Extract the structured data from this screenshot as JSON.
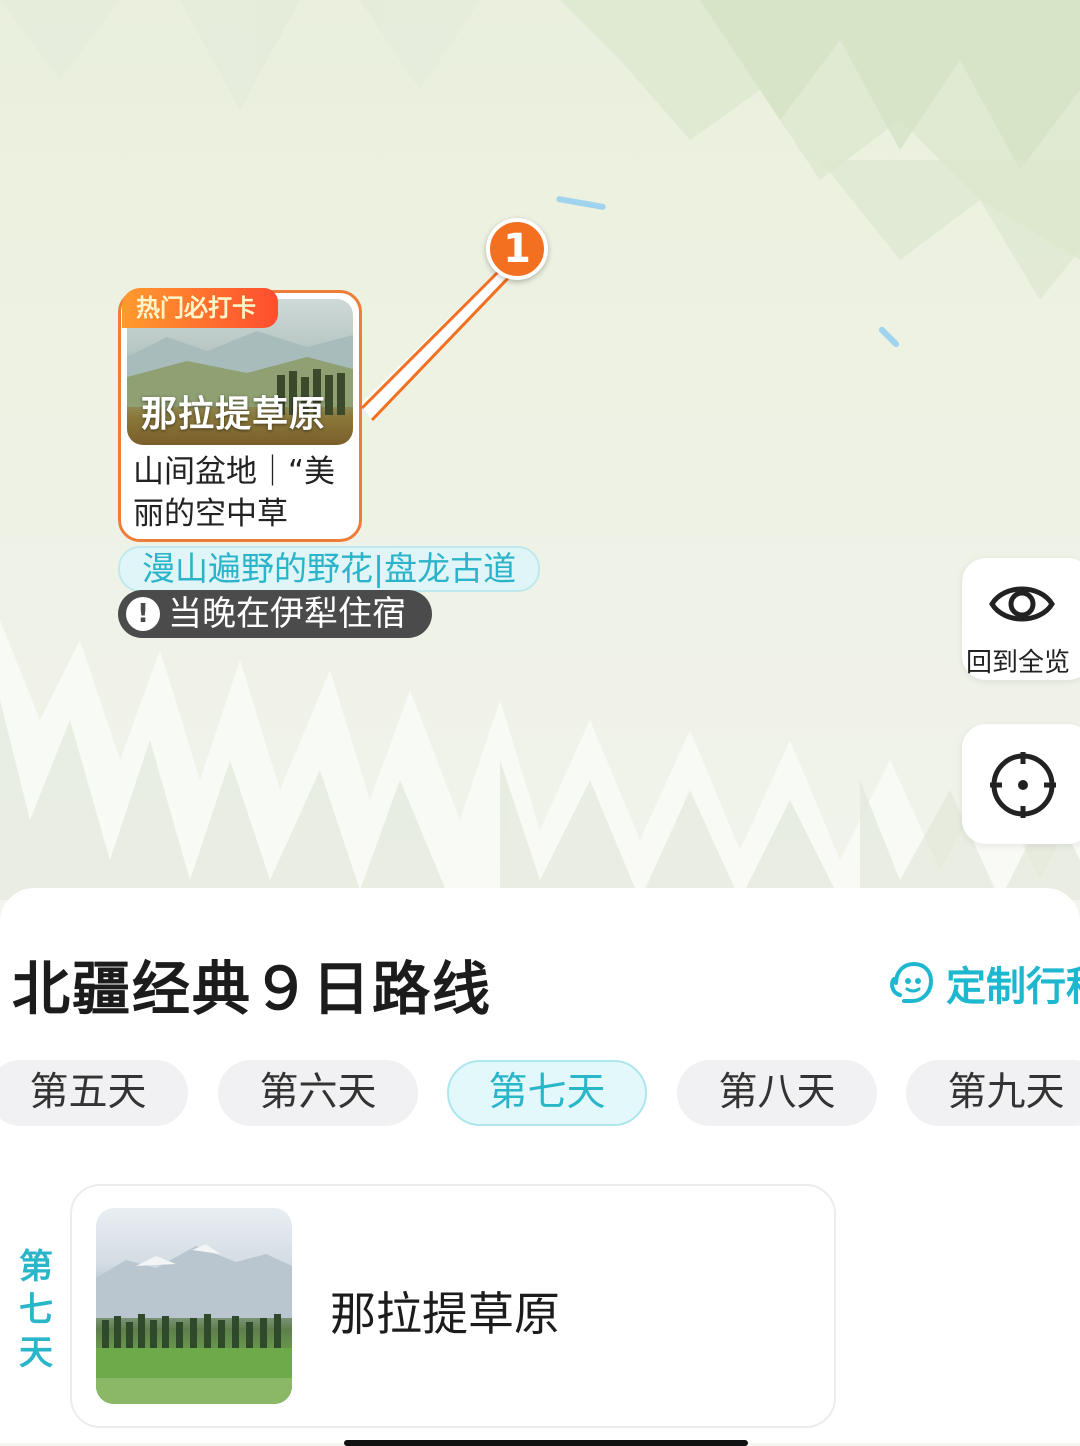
{
  "map": {
    "marker_number": "1",
    "poi": {
      "hot_tag": "热门必打卡",
      "title": "那拉提草原",
      "description": "山间盆地｜“美丽的空中草"
    },
    "tag_line": "漫山遍野的野花|盘龙古道",
    "notice": "当晚在伊犁住宿",
    "overview_button_label": "回到全览",
    "overview_icon": "eye-icon",
    "locate_icon": "locate-crosshair-icon"
  },
  "sheet": {
    "title": "北疆经典９日路线",
    "custom_link": "定制行程",
    "custom_icon": "customer-service-icon",
    "days": [
      "第五天",
      "第六天",
      "第七天",
      "第八天",
      "第九天"
    ],
    "active_day": "第七天",
    "day_vertical": [
      "第",
      "七",
      "天"
    ],
    "spot": {
      "name": "那拉提草原"
    }
  },
  "colors": {
    "accent_cyan": "#2ab6c9",
    "marker_orange": "#f2701f",
    "notice_dark": "#4b4b4b"
  }
}
